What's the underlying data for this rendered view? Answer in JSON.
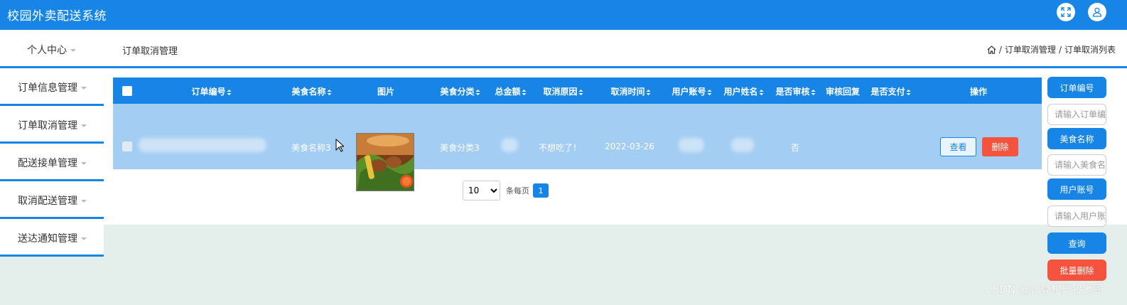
{
  "app_title": "校园外卖配送系统",
  "user_center": "个人中心",
  "page_title": "订单取消管理",
  "breadcrumb": {
    "sep": "/",
    "level1": "订单取消管理",
    "level2": "订单取消列表"
  },
  "sidebar": {
    "items": [
      {
        "label": "订单信息管理"
      },
      {
        "label": "订单取消管理"
      },
      {
        "label": "配送接单管理"
      },
      {
        "label": "取消配送管理"
      },
      {
        "label": "送达通知管理"
      }
    ]
  },
  "table": {
    "headers": [
      {
        "label": "订单编号",
        "sortable": true
      },
      {
        "label": "美食名称",
        "sortable": true
      },
      {
        "label": "图片",
        "sortable": false
      },
      {
        "label": "美食分类",
        "sortable": true
      },
      {
        "label": "总金额",
        "sortable": true
      },
      {
        "label": "取消原因",
        "sortable": true
      },
      {
        "label": "取消时间",
        "sortable": true
      },
      {
        "label": "用户账号",
        "sortable": true
      },
      {
        "label": "用户姓名",
        "sortable": true
      },
      {
        "label": "是否审核",
        "sortable": true
      },
      {
        "label": "审核回复",
        "sortable": false
      },
      {
        "label": "是否支付",
        "sortable": true
      },
      {
        "label": "操作",
        "sortable": false
      }
    ],
    "rows": [
      {
        "food_name": "美食名称3",
        "category": "美食分类3",
        "cancel_reason": "不想吃了！",
        "cancel_time": "2022-03-26",
        "approved": "否",
        "view_label": "查看",
        "delete_label": "删除"
      }
    ]
  },
  "pagination": {
    "page_size": "10",
    "page_size_options": [
      "10"
    ],
    "per_page_label": "条每页",
    "current_page": "1"
  },
  "search": {
    "order_no_label": "订单编号",
    "order_no_placeholder": "请输入订单编号",
    "food_name_label": "美食名称",
    "food_name_placeholder": "请输入美食名称",
    "user_account_label": "用户账号",
    "user_account_placeholder": "请输入用户账号",
    "query_label": "查询",
    "batch_delete_label": "批量删除"
  },
  "watermark": "CSDN @计算机毕设老哥",
  "colors": {
    "primary": "#1785e6",
    "danger": "#f5533d",
    "row_bg": "#a3cdf2",
    "page_bg": "#e4efeb"
  }
}
